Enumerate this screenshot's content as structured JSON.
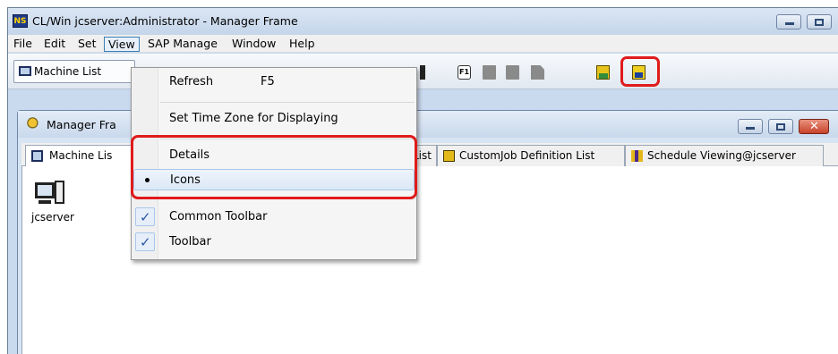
{
  "window": {
    "title": "CL/Win jcserver:Administrator - Manager Frame",
    "app_icon_text": "NS"
  },
  "menubar": {
    "items": [
      "File",
      "Edit",
      "Set",
      "View",
      "SAP Manage",
      "Window",
      "Help"
    ],
    "active": "View"
  },
  "toolbar": {
    "machine_list_label": "Machine List",
    "icons": [
      "f1-help-icon",
      "folder-icon",
      "folder-grid-icon",
      "document-icon",
      "machine-group-icon",
      "switch-machine-icon"
    ]
  },
  "child_window": {
    "title": "Manager Fra",
    "tabs": [
      {
        "label": "Machine Lis",
        "icon": "machine-list-icon"
      },
      {
        "label": "List",
        "icon": ""
      },
      {
        "label": "CustomJob Definition List",
        "icon": "customjob-icon"
      },
      {
        "label": "Schedule Viewing@jcserver",
        "icon": "schedule-icon"
      }
    ]
  },
  "content": {
    "machines": [
      {
        "label": "jcserver",
        "icon": "server-icon"
      }
    ]
  },
  "view_menu": {
    "items": [
      {
        "label": "Refresh",
        "accel": "F5"
      },
      {
        "label": "Set Time Zone for Displaying"
      },
      {
        "label": "Details"
      },
      {
        "label": "Icons",
        "selected": true
      },
      {
        "label": "Common Toolbar",
        "checked": true
      },
      {
        "label": "Toolbar",
        "checked": true
      }
    ]
  },
  "colors": {
    "highlight": "#e11b1b",
    "title_bg": "#c9d9ee",
    "check": "#2e57a8"
  }
}
